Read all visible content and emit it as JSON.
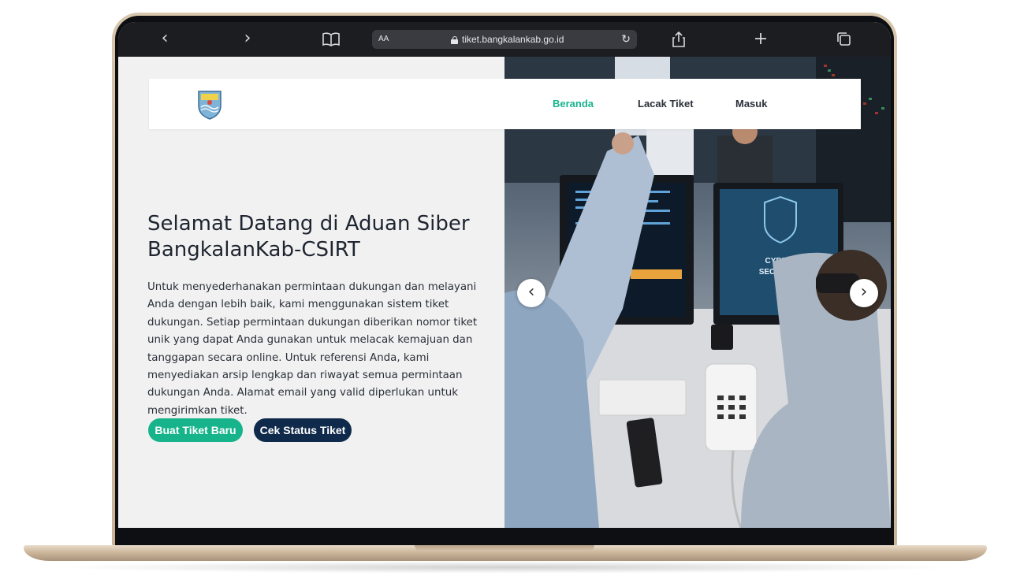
{
  "browser": {
    "text_size_label": "AA",
    "url": "tiket.bangkalankab.go.id",
    "back_icon": "‹",
    "forward_icon": "›",
    "reload_icon": "↻"
  },
  "navbar": {
    "links": [
      {
        "label": "Beranda",
        "active": true
      },
      {
        "label": "Lacak Tiket",
        "active": false
      },
      {
        "label": "Masuk",
        "active": false
      }
    ]
  },
  "hero": {
    "title": "Selamat Datang di Aduan Siber BangkalanKab-CSIRT",
    "description": "Untuk menyederhanakan permintaan dukungan dan melayani Anda dengan lebih baik, kami menggunakan sistem tiket dukungan. Setiap permintaan dukungan diberikan nomor tiket unik yang dapat Anda gunakan untuk melacak kemajuan dan tanggapan secara online. Untuk referensi Anda, kami menyediakan arsip lengkap dan riwayat semua permintaan dukungan Anda. Alamat email yang valid diperlukan untuk mengirimkan tiket.",
    "primary_button": "Buat Tiket Baru",
    "secondary_button": "Cek Status Tiket"
  },
  "carousel": {
    "prev_icon": "‹",
    "next_icon": "›",
    "monitor_text": [
      "CYBER",
      "SECURITY"
    ]
  },
  "colors": {
    "accent": "#17b48b",
    "dark_navy": "#0f2a4a",
    "browser_bar": "#1c1d21"
  }
}
